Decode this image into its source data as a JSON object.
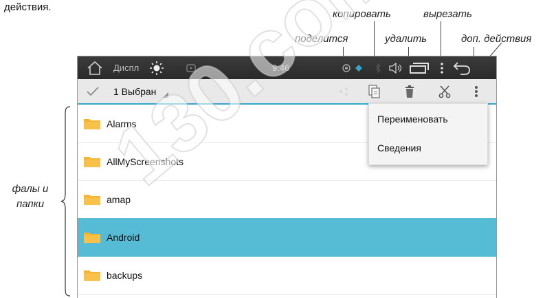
{
  "intro_text": "действия.",
  "callouts": {
    "copy": "копировать",
    "cut": "вырезать",
    "share": "поделится",
    "delete": "удалить",
    "more": "доп. действия",
    "files": "фалы и папки"
  },
  "statusbar": {
    "app_title": "Диспл",
    "time": "9:46"
  },
  "actionbar": {
    "selection_label": "1 Выбран"
  },
  "files": [
    {
      "name": "Alarms",
      "selected": false
    },
    {
      "name": "AllMyScreenshots",
      "selected": false
    },
    {
      "name": "amap",
      "selected": false
    },
    {
      "name": "Android",
      "selected": true
    },
    {
      "name": "backups",
      "selected": false
    }
  ],
  "menu": {
    "items": [
      "Переименовать",
      "Сведения"
    ]
  },
  "watermark": "130.com.ua",
  "colors": {
    "accent": "#34a6cc",
    "selected_row": "#56bcd6",
    "folder": "#f5b532",
    "statusbar": "#2e2e2e"
  }
}
